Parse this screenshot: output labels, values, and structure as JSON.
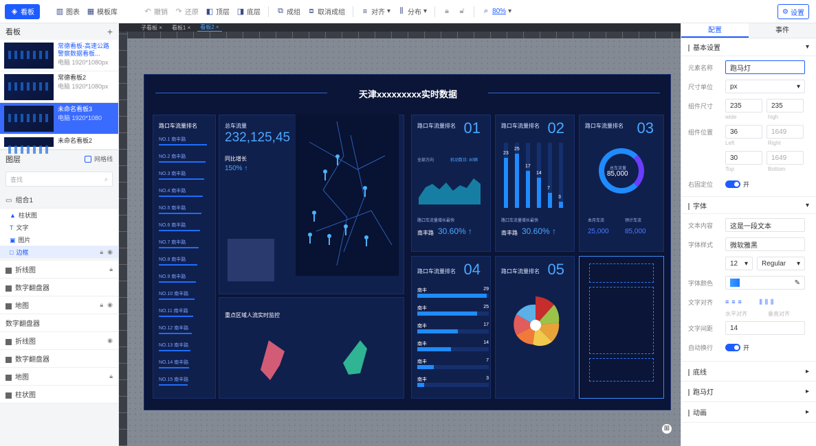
{
  "toolbar": {
    "board": "看板",
    "chart": "图表",
    "template": "模板库",
    "undo": "撤销",
    "redo": "还原",
    "top": "顶层",
    "bottom": "底层",
    "group": "成组",
    "ungroup": "取消成组",
    "align": "对齐",
    "distribute": "分布",
    "zoom": "80%",
    "settings": "设置"
  },
  "left": {
    "boards_title": "看板",
    "boards": [
      {
        "name": "常德看板-高速公路警察数据看板...",
        "size": "电脑 1920*1080px"
      },
      {
        "name": "常德看板2",
        "size": "电脑 1920*1080px"
      },
      {
        "name": "未命名看板3",
        "size": "电脑 1920*1080"
      },
      {
        "name": "未命名看板2",
        "size": ""
      }
    ],
    "layers_title": "图层",
    "grid_label": "网格线",
    "search_placeholder": "查找",
    "layers": [
      {
        "name": "组合1"
      },
      {
        "name": "柱状图"
      },
      {
        "name": "文字"
      },
      {
        "name": "图片"
      },
      {
        "name": "边框"
      },
      {
        "name": "折线图"
      },
      {
        "name": "数字翻盘器"
      },
      {
        "name": "地图"
      },
      {
        "name": "数字翻盘器"
      },
      {
        "name": "折线图"
      },
      {
        "name": "数字翻盘器"
      },
      {
        "name": "地图"
      },
      {
        "name": "柱状图"
      }
    ]
  },
  "tabs": [
    "子看板 ×",
    "看板1 ×",
    "看板2 ×"
  ],
  "dashboard": {
    "title": "天津xxxxxxxxx实时数据",
    "rank_title": "路口车流量排名",
    "rank": [
      "NO.1 南丰路",
      "NO.2 南丰路",
      "NO.3 南丰路",
      "NO.4 南丰路",
      "NO.5 南丰路",
      "NO.6 南丰路",
      "NO.7 南丰路",
      "NO.8 南丰路",
      "NO.9 南丰路",
      "NO.10 南丰路",
      "NO.11 南丰路",
      "NO.12 南丰路",
      "NO.13 南丰路",
      "NO.14 南丰路",
      "NO.15 南丰路"
    ],
    "total_label": "总车流量",
    "total_value": "232,125,45",
    "growth_label": "同比增长",
    "growth_value": "150% ↑",
    "radar_title": "重点区域人流实时监控",
    "p01": {
      "title": "路口车流量排名",
      "num": "01",
      "legend1": "全部方向",
      "legend2": "机动数日: 80辆",
      "kpi_label": "路口车流量增长最快",
      "kpi_road": "南丰路",
      "kpi_value": "30.60% ↑"
    },
    "p02": {
      "title": "路口车流量排名",
      "num": "02",
      "bar_labels": [
        "23",
        "25",
        "17",
        "14",
        "7",
        "3"
      ],
      "kpi_label": "路口车流量增长最快",
      "kpi_road": "南丰路",
      "kpi_value": "30.60% ↑"
    },
    "p03": {
      "title": "路口车流量排名",
      "num": "03",
      "donut_label": "总车流量",
      "donut_value": "85,000",
      "stat1_label": "本月车流",
      "stat1_value": "25,000",
      "stat2_label": "预计车流",
      "stat2_value": "85,000"
    },
    "p04": {
      "title": "路口车流量排名",
      "num": "04",
      "rows": [
        {
          "name": "南丰",
          "value": "29"
        },
        {
          "name": "南丰",
          "value": "25"
        },
        {
          "name": "南丰",
          "value": "17"
        },
        {
          "name": "南丰",
          "value": "14"
        },
        {
          "name": "南丰",
          "value": "7"
        },
        {
          "name": "南丰",
          "value": "3"
        }
      ]
    },
    "p05": {
      "title": "路口车流量排名",
      "num": "05"
    }
  },
  "right": {
    "tab_config": "配置",
    "tab_events": "事件",
    "basic": "基本设置",
    "name_label": "元素名称",
    "name_value": "跑马灯",
    "unit_label": "尺寸单位",
    "unit_value": "px",
    "size_label": "组件尺寸",
    "width": "235",
    "height": "235",
    "wide": "wide",
    "high": "high",
    "pos_label": "组件位置",
    "left": "36",
    "right": "1649",
    "left_cap": "Left",
    "right_cap": "Right",
    "top": "30",
    "bottom": "1649",
    "top_cap": "Top",
    "bottom_cap": "Bottom",
    "anchor_label": "右固定位",
    "anchor_value": "开",
    "font_sec": "字体",
    "text_label": "文本内容",
    "text_value": "这是一段文本",
    "style_label": "字体样式",
    "style_value": "微软雅黑",
    "font_size": "12",
    "font_weight": "Regular",
    "color_label": "字体颜色",
    "align_label": "文字对齐",
    "h_align": "水平对齐",
    "v_align": "垂直对齐",
    "spacing_label": "文字间距",
    "spacing_value": "14",
    "wrap_label": "自动换行",
    "wrap_value": "开",
    "border_sec": "底线",
    "marquee_sec": "跑马灯",
    "anim_sec": "动画"
  }
}
